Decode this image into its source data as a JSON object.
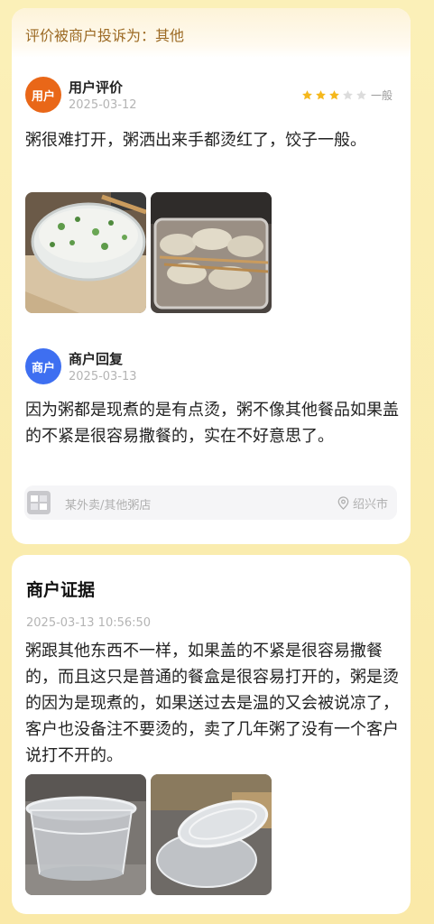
{
  "complaint_banner": "评价被商户投诉为：其他",
  "review": {
    "avatar_label": "用户",
    "author": "用户评价",
    "date": "2025-03-12",
    "rating_stars": 3,
    "rating_max": 5,
    "rating_label": "一般",
    "text": "粥很难打开，粥洒出来手都烫红了，饺子一般。",
    "photos": [
      "congee-bowl-photo",
      "dumplings-box-photo"
    ]
  },
  "reply": {
    "avatar_label": "商户",
    "author": "商户回复",
    "date": "2025-03-13",
    "text": "因为粥都是现煮的是有点烫，粥不像其他餐品如果盖的不紧是很容易撒餐的，实在不好意思了。"
  },
  "store": {
    "name": "某外卖/其他粥店",
    "location": "绍兴市"
  },
  "evidence": {
    "title": "商户证据",
    "timestamp": "2025-03-13 10:56:50",
    "text": "粥跟其他东西不一样，如果盖的不紧是很容易撒餐的，而且这只是普通的餐盒是很容易打开的，粥是烫的因为是现煮的，如果送过去是温的又会被说凉了，客户也没备注不要烫的，卖了几年粥了没有一个客户说打不开的。",
    "photos": [
      "empty-container-photo",
      "container-lid-photo"
    ]
  },
  "colors": {
    "star_on": "#f5b81c",
    "star_off": "#dcdcdc",
    "user_avatar": "#e96718",
    "merchant_avatar": "#3e6ff1",
    "banner_text": "#9c6a24"
  }
}
